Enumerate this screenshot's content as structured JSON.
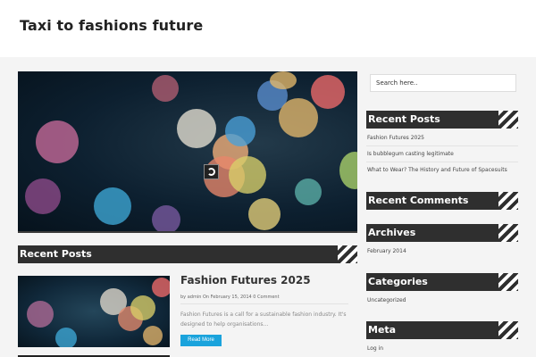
{
  "site": {
    "title": "Taxi to fashions future"
  },
  "main": {
    "recent_posts_heading": "Recent Posts",
    "featured_post": {
      "title": "Fashion Futures 2025",
      "meta": "by admin On February 15, 2014 0 Comment",
      "excerpt": "Fashion Futures is a call for a sustainable fashion industry. It's designed to help organisations...",
      "read_more_label": "Read More"
    }
  },
  "sidebar": {
    "search": {
      "placeholder": "Search here.."
    },
    "recent_posts": {
      "heading": "Recent Posts",
      "items": [
        "Fashion Futures 2025",
        "Is bubblegum casting legitimate",
        "What to Wear? The History and Future of Spacesuits"
      ]
    },
    "recent_comments": {
      "heading": "Recent Comments"
    },
    "archives": {
      "heading": "Archives",
      "items": [
        "February 2014"
      ]
    },
    "categories": {
      "heading": "Categories",
      "items": [
        "Uncategorized"
      ]
    },
    "meta": {
      "heading": "Meta",
      "items": [
        "Log in"
      ]
    }
  },
  "colors": {
    "header_bg": "#ffffff",
    "page_bg": "#f4f4f4",
    "widget_bar": "#2f2f2f",
    "button_accent": "#1aa3dc"
  }
}
